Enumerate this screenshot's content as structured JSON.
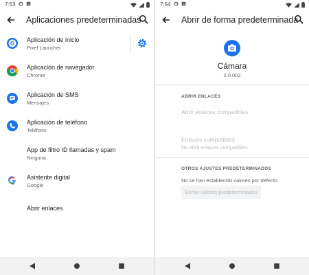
{
  "left": {
    "status": {
      "time": "7:53"
    },
    "appbar": {
      "title": "Aplicaciones predeterminadas"
    },
    "items": [
      {
        "title": "Aplicación de inicio",
        "subtitle": "Pixel Launcher",
        "icon": "pixel-launcher-icon"
      },
      {
        "title": "Aplicación de navegador",
        "subtitle": "Chrome",
        "icon": "chrome-icon"
      },
      {
        "title": "Aplicación de SMS",
        "subtitle": "Mensajes",
        "icon": "messages-icon"
      },
      {
        "title": "Aplicación de teléfono",
        "subtitle": "Teléfono",
        "icon": "phone-icon"
      },
      {
        "title": "App de filtro ID llamadas y spam",
        "subtitle": "Ninguna",
        "icon": ""
      },
      {
        "title": "Asistente digital",
        "subtitle": "Google",
        "icon": "google-icon"
      },
      {
        "title": "Abrir enlaces",
        "subtitle": "",
        "icon": ""
      }
    ]
  },
  "right": {
    "status": {
      "time": "7:54"
    },
    "appbar": {
      "title": "Abrir de forma predeterminada"
    },
    "app": {
      "name": "Cámara",
      "version": "2.0.002",
      "icon": "camera-icon"
    },
    "section1": {
      "header": "ABRIR ENLACES",
      "open_supported": "Abrir enlaces compatibles",
      "supported_links": "Enlaces compatibles",
      "supported_links_sub": "No abrir enlaces compatibles"
    },
    "section2": {
      "header": "OTROS AJUSTES PREDETERMINADOS",
      "info": "No se han establecido valores por defecto",
      "button": "Borrar valores predeterminados"
    }
  },
  "colors": {
    "accent": "#1a73e8",
    "nav_bg": "#f2f2f2",
    "divider": "#dadce0",
    "disabled_text": "#b9bcc0"
  }
}
